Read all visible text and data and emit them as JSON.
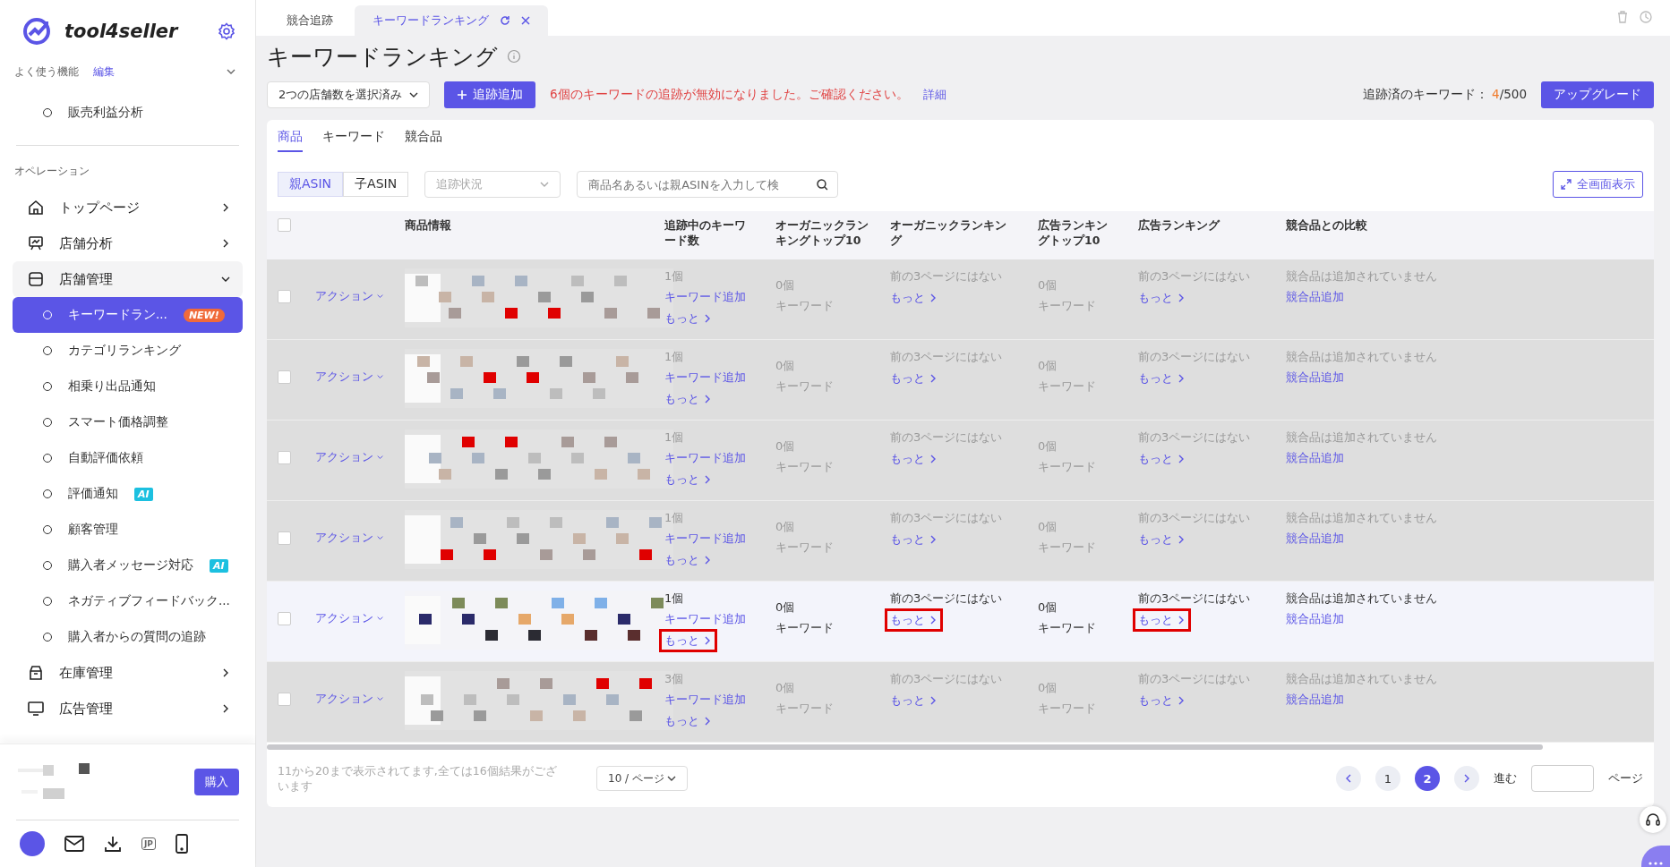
{
  "sidebar": {
    "brand": "tool4seller",
    "favorites_label": "よく使う機能",
    "favorites_edit": "編集",
    "favorites": [
      {
        "label": "販売利益分析"
      }
    ],
    "section_label": "オペレーション",
    "menu": [
      {
        "label": "トップページ",
        "kind": "home",
        "expanded": false
      },
      {
        "label": "店舗分析",
        "kind": "chart",
        "expanded": false
      },
      {
        "label": "店舗管理",
        "kind": "store",
        "expanded": true,
        "children": [
          {
            "label": "キーワードラン...",
            "badge": "NEW!",
            "kind": "new",
            "selected": true
          },
          {
            "label": "カテゴリランキング",
            "selected": false
          },
          {
            "label": "相乗り出品通知",
            "selected": false
          },
          {
            "label": "スマート価格調整",
            "selected": false
          },
          {
            "label": "自動評価依頼",
            "selected": false
          },
          {
            "label": "評価通知",
            "badge": "AI",
            "kind": "ai",
            "selected": false
          },
          {
            "label": "顧客管理",
            "selected": false
          },
          {
            "label": "購入者メッセージ対応",
            "badge": "AI",
            "kind": "ai",
            "selected": false
          },
          {
            "label": "ネガティブフィードバック...",
            "selected": false
          },
          {
            "label": "購入者からの質問の追跡",
            "selected": false
          }
        ]
      },
      {
        "label": "在庫管理",
        "kind": "box",
        "expanded": false
      },
      {
        "label": "広告管理",
        "kind": "monitor",
        "expanded": false
      }
    ],
    "buy_button": "購入",
    "region_badge": "JP"
  },
  "tabs": [
    {
      "label": "競合追跡",
      "selected": false
    },
    {
      "label": "キーワードランキング",
      "selected": true
    }
  ],
  "page": {
    "title": "キーワードランキング",
    "store_select": "2つの店舗数を選択済み",
    "add_button": "追跡追加",
    "warning": "6個のキーワードの追跡が無効になりました。ご確認ください。",
    "detail_link": "詳細",
    "tracked_label": "追跡済のキーワード：",
    "tracked_used": "4",
    "tracked_total": "/500",
    "upgrade_button": "アップグレード"
  },
  "subtabs": [
    {
      "label": "商品",
      "selected": true
    },
    {
      "label": "キーワード",
      "selected": false
    },
    {
      "label": "競合品",
      "selected": false
    }
  ],
  "asin_toggle": [
    {
      "label": "親ASIN",
      "selected": true
    },
    {
      "label": "子ASIN",
      "selected": false
    }
  ],
  "status_filter": {
    "placeholder": "追跡状況"
  },
  "search": {
    "placeholder": "商品名あるいは親ASINを入力して検"
  },
  "fullscreen_button": "全画面表示",
  "table": {
    "all_checked": false,
    "columns": [
      "商品情報",
      "追跡中のキーワード数",
      "オーガニックランキングトップ10",
      "オーガニックランキング",
      "広告ランキングトップ10",
      "広告ランキング",
      "競合品との比較"
    ],
    "rows": [
      {
        "checked": false,
        "dimmed": true,
        "annotated": false,
        "action": "アクション",
        "count": "1個",
        "add_keyword": "キーワード追加",
        "more": "もっと",
        "organic_top": "0個",
        "organic_top_unit": "キーワード",
        "organic_rank": "前の3ページにはない",
        "organic_more": "もっと",
        "ad_top": "0個",
        "ad_top_unit": "キーワード",
        "ad_rank": "前の3ページにはない",
        "ad_more": "もっと",
        "comparison": "競合品は追加されていません",
        "add_competitor": "競合品追加"
      },
      {
        "checked": false,
        "dimmed": true,
        "annotated": false,
        "action": "アクション",
        "count": "1個",
        "add_keyword": "キーワード追加",
        "more": "もっと",
        "organic_top": "0個",
        "organic_top_unit": "キーワード",
        "organic_rank": "前の3ページにはない",
        "organic_more": "もっと",
        "ad_top": "0個",
        "ad_top_unit": "キーワード",
        "ad_rank": "前の3ページにはない",
        "ad_more": "もっと",
        "comparison": "競合品は追加されていません",
        "add_competitor": "競合品追加"
      },
      {
        "checked": false,
        "dimmed": true,
        "annotated": false,
        "action": "アクション",
        "count": "1個",
        "add_keyword": "キーワード追加",
        "more": "もっと",
        "organic_top": "0個",
        "organic_top_unit": "キーワード",
        "organic_rank": "前の3ページにはない",
        "organic_more": "もっと",
        "ad_top": "0個",
        "ad_top_unit": "キーワード",
        "ad_rank": "前の3ページにはない",
        "ad_more": "もっと",
        "comparison": "競合品は追加されていません",
        "add_competitor": "競合品追加"
      },
      {
        "checked": false,
        "dimmed": true,
        "annotated": false,
        "action": "アクション",
        "count": "1個",
        "add_keyword": "キーワード追加",
        "more": "もっと",
        "organic_top": "0個",
        "organic_top_unit": "キーワード",
        "organic_rank": "前の3ページにはない",
        "organic_more": "もっと",
        "ad_top": "0個",
        "ad_top_unit": "キーワード",
        "ad_rank": "前の3ページにはない",
        "ad_more": "もっと",
        "comparison": "競合品は追加されていません",
        "add_competitor": "競合品追加"
      },
      {
        "checked": false,
        "dimmed": false,
        "annotated": true,
        "action": "アクション",
        "count": "1個",
        "add_keyword": "キーワード追加",
        "more": "もっと",
        "organic_top": "0個",
        "organic_top_unit": "キーワード",
        "organic_rank": "前の3ページにはない",
        "organic_more": "もっと",
        "ad_top": "0個",
        "ad_top_unit": "キーワード",
        "ad_rank": "前の3ページにはない",
        "ad_more": "もっと",
        "comparison": "競合品は追加されていません",
        "add_competitor": "競合品追加"
      },
      {
        "checked": false,
        "dimmed": true,
        "annotated": false,
        "action": "アクション",
        "count": "3個",
        "add_keyword": "キーワード追加",
        "more": "もっと",
        "organic_top": "0個",
        "organic_top_unit": "キーワード",
        "organic_rank": "前の3ページにはない",
        "organic_more": "もっと",
        "ad_top": "0個",
        "ad_top_unit": "キーワード",
        "ad_rank": "前の3ページにはない",
        "ad_more": "もっと",
        "comparison": "競合品は追加されていません",
        "add_competitor": "競合品追加"
      }
    ]
  },
  "pagination": {
    "summary": "11から20まで表示されてます,全ては16個結果がございます",
    "page_size": "10 / ページ",
    "pages": [
      {
        "label": "1",
        "selected": false
      },
      {
        "label": "2",
        "selected": true
      }
    ],
    "goto_label": "進む",
    "goto_suffix": "ページ"
  }
}
